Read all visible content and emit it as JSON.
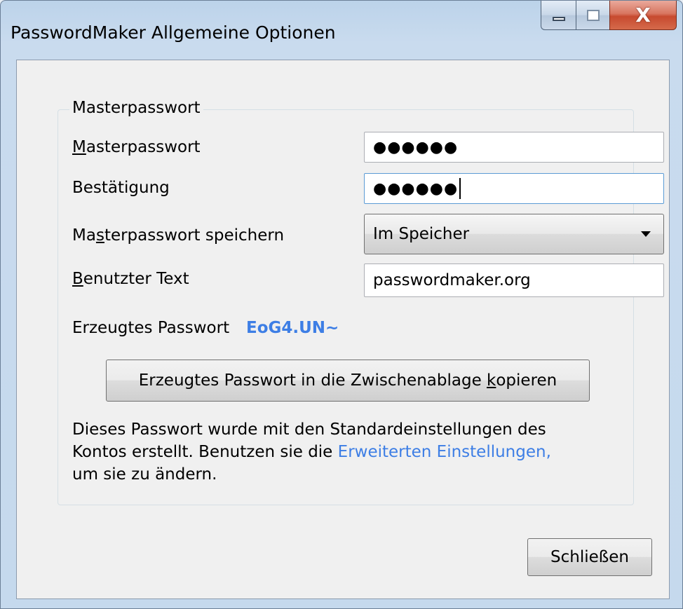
{
  "window": {
    "title": "PasswordMaker Allgemeine Optionen",
    "close_glyph": "X"
  },
  "group": {
    "title": "Masterpasswort"
  },
  "form": {
    "master_password": {
      "label_access_key": "M",
      "label_rest": "asterpasswort",
      "value_masked": "●●●●●●"
    },
    "confirmation": {
      "label": "Bestätigung",
      "value_masked": "●●●●●●"
    },
    "save_master": {
      "label_before": "Ma",
      "label_access_key": "s",
      "label_after": "terpasswort speichern",
      "selected": "Im Speicher"
    },
    "used_text": {
      "label_access_key": "B",
      "label_rest": "enutzter Text",
      "value": "passwordmaker.org"
    },
    "generated": {
      "label": "Erzeugtes Passwort",
      "value": "EoG4.UN~"
    }
  },
  "copy_button": {
    "label_before": "Erzeugtes Passwort in die Zwischenablage ",
    "label_access_key": "k",
    "label_after": "opieren"
  },
  "description": {
    "line1": "Dieses Passwort wurde mit den Standardeinstellungen des",
    "line2_text": "Kontos erstellt. Benutzen sie die ",
    "line2_link": "Erweiterten Einstellungen,",
    "line3": "um sie zu ändern."
  },
  "close_button": {
    "label": "Schließen"
  },
  "colors": {
    "accent_link": "#3d7ee5"
  }
}
